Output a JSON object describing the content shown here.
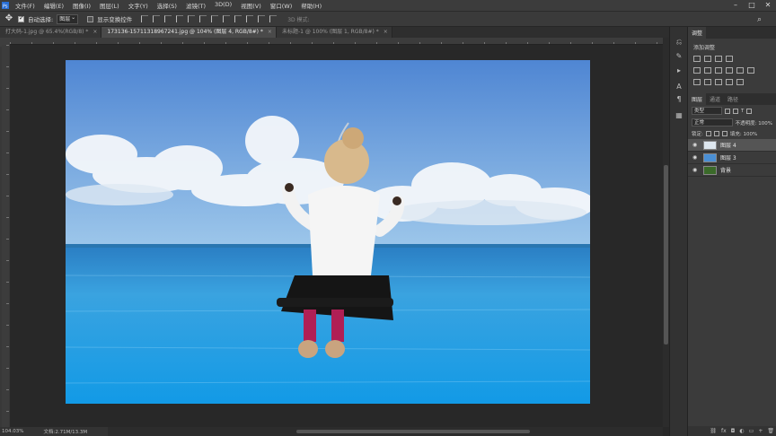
{
  "menubar": {
    "items": [
      "文件(F)",
      "编辑(E)",
      "图像(I)",
      "图层(L)",
      "文字(Y)",
      "选择(S)",
      "滤镜(T)",
      "3D(D)",
      "视图(V)",
      "窗口(W)",
      "帮助(H)"
    ]
  },
  "options": {
    "auto_select_label": "自动选择:",
    "auto_select_value": "图层",
    "show_transform_label": "显示变换控件",
    "mode3d_label": "3D 模式:"
  },
  "tabs": [
    {
      "label": "打大码-1.jpg @ 65.4%(RGB/8) *"
    },
    {
      "label": "173136-15711318967241.jpg @ 104% (图层 4, RGB/8#) *"
    },
    {
      "label": "未标题-1 @ 100% (图层 1, RGB/8#) *"
    }
  ],
  "status": {
    "zoom": "104.03%",
    "doc": "文档:2.71M/13.3M"
  },
  "panels": {
    "top_tab": "调整",
    "adjust_title": "添加调整",
    "layer_tabs": [
      "图层",
      "通道",
      "路径"
    ],
    "kind_label": "类型",
    "blend_mode": "正常",
    "opacity_label": "不透明度: 100%",
    "lock_label": "锁定:",
    "fill_label": "填充: 100%",
    "layers": [
      {
        "name": "图层 4",
        "thumb_color": "#dde6ee",
        "active": true
      },
      {
        "name": "图层 3",
        "thumb_color": "#4a8fd4",
        "active": false
      },
      {
        "name": "背景",
        "thumb_color": "#3b6a2a",
        "active": false
      }
    ],
    "footer_icons": [
      "link-icon",
      "fx-icon",
      "mask-icon",
      "adjust-icon",
      "folder-icon",
      "new-layer-icon",
      "trash-icon"
    ]
  },
  "colors": {
    "sky_top": "#4f86d3",
    "sky_horizon": "#9cc6ea",
    "water_far": "#2b8fd1",
    "water_near": "#1aa0e6"
  }
}
